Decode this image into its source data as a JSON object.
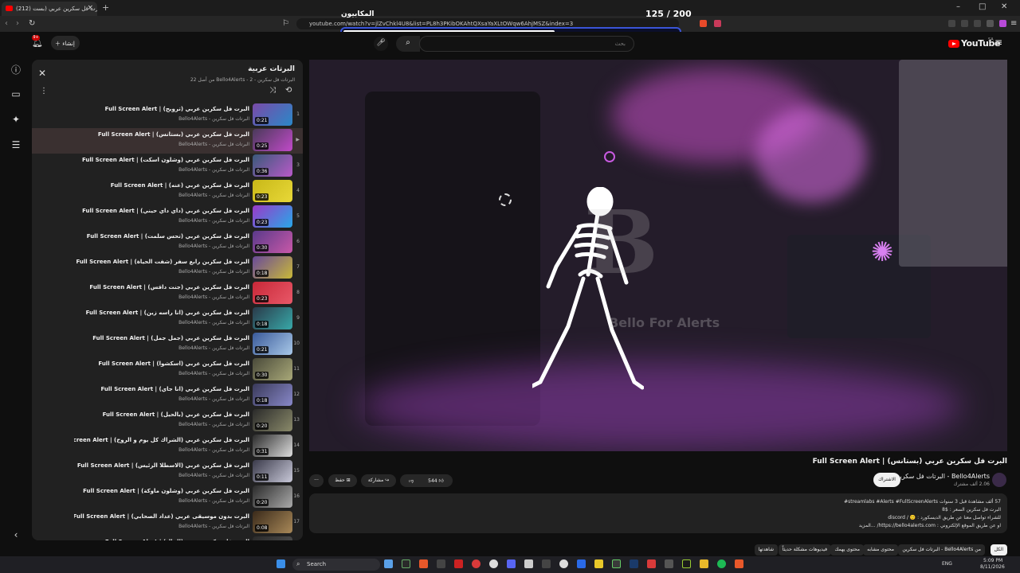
{
  "browser": {
    "tab_title": "البرت فل سكرين عربي (بست...",
    "tab_count": "(212)",
    "url": "youtube.com/watch?v=jlZvChkl4U8&list=PL8h3PKibOKAhtQXsaYaXLtOWqw6AhjMSZ&index=3"
  },
  "overlay": {
    "title": "المكابيون",
    "count": "125 / 200",
    "progress": 0.625
  },
  "header": {
    "create_label": "إنشاء",
    "search_placeholder": "بحث",
    "logo_text": "YouTube",
    "logo_region": "SA"
  },
  "playlist": {
    "title": "البرتات عربية",
    "subtitle": "البرتات فل سكرين - Bello4Alerts - 2 من أصل 22",
    "items": [
      {
        "n": "1",
        "title": "البرت فل سكرين عربي (ترويح) | Full Screen Alert",
        "channel": "البرتات فل سكرين - Bello4Alerts",
        "dur": "0:21",
        "c1": "#7a4aa8",
        "c2": "#2a88c8"
      },
      {
        "n": "▶",
        "title": "البرت فل سكرين عربي (بستانس) | Full Screen Alert",
        "channel": "البرتات فل سكرين - Bello4Alerts",
        "dur": "0:25",
        "c1": "#4a3a5a",
        "c2": "#c04ac8"
      },
      {
        "n": "3",
        "title": "البرت فل سكرين عربي (وشلون اسكت) | Full Screen Alert",
        "channel": "البرتات فل سكرين - Bello4Alerts",
        "dur": "0:36",
        "c1": "#3a5a7a",
        "c2": "#b85ac8"
      },
      {
        "n": "4",
        "title": "البرت فل سكرين عربي (عنه) | Full Screen Alert",
        "channel": "البرتات فل سكرين - Bello4Alerts",
        "dur": "0:23",
        "c1": "#c8b818",
        "c2": "#e8d838"
      },
      {
        "n": "5",
        "title": "البرت فل سكرين عربي (داي داي حيني) | Full Screen Alert",
        "channel": "البرتات فل سكرين - Bello4Alerts",
        "dur": "0:23",
        "c1": "#9a3ac8",
        "c2": "#28a8e8"
      },
      {
        "n": "6",
        "title": "البرت فل سكرين عربي (تحس سلمت) | Full Screen Alert",
        "channel": "البرتات فل سكرين - Bello4Alerts",
        "dur": "0:30",
        "c1": "#5a3a8a",
        "c2": "#c858a8"
      },
      {
        "n": "7",
        "title": "البرت فل سكرين رابع سفر (شفت الحياة) | Full Screen Alert",
        "channel": "البرتات فل سكرين - Bello4Alerts",
        "dur": "0:18",
        "c1": "#6a4a9a",
        "c2": "#c8b838"
      },
      {
        "n": "8",
        "title": "البرت فل سكرين عربي (جنت داقس) | Full Screen Alert",
        "channel": "البرتات فل سكرين - Bello4Alerts",
        "dur": "0:23",
        "c1": "#c82838",
        "c2": "#e85868"
      },
      {
        "n": "9",
        "title": "البرت فل سكرين عربي (انا راسه زين) | Full Screen Alert",
        "channel": "البرتات فل سكرين - Bello4Alerts",
        "dur": "0:18",
        "c1": "#2a3a4a",
        "c2": "#38a8a8"
      },
      {
        "n": "10",
        "title": "البرت فل سكرين عربي (جمل جمل) | Full Screen Alert",
        "channel": "البرتات فل سكرين - Bello4Alerts",
        "dur": "0:21",
        "c1": "#3a5a9a",
        "c2": "#a8c8e8"
      },
      {
        "n": "11",
        "title": "البرت فل سكرين عربي (اسكشوا) | Full Screen Alert",
        "channel": "البرتات فل سكرين - Bello4Alerts",
        "dur": "0:30",
        "c1": "#4a4a3a",
        "c2": "#a8a878"
      },
      {
        "n": "12",
        "title": "البرت فل سكرين عربي (انا جاي) | Full Screen Alert",
        "channel": "البرتات فل سكرين - Bello4Alerts",
        "dur": "0:18",
        "c1": "#3a3a5a",
        "c2": "#8888c8"
      },
      {
        "n": "13",
        "title": "البرت فل سكرين عربي (بالحيل) | Full Screen Alert",
        "channel": "البرتات فل سكرين - Bello4Alerts",
        "dur": "0:20",
        "c1": "#2a2a2a",
        "c2": "#8a8a6a"
      },
      {
        "n": "14",
        "title": "البرت فل سكرين عربي (الشراك كل يوم و الروح) | Full Screen Alert",
        "channel": "البرتات فل سكرين - Bello4Alerts",
        "dur": "0:31",
        "c1": "#2a2a2a",
        "c2": "#dddddd"
      },
      {
        "n": "15",
        "title": "البرت فل سكرين عربي (الاسطلا الرئيس) | Full Screen Alert",
        "channel": "البرتات فل سكرين - Bello4Alerts",
        "dur": "0:11",
        "c1": "#3a3a4a",
        "c2": "#c8c8d8"
      },
      {
        "n": "16",
        "title": "البرت فل سكرين عربي (وشلون ماوكة) | Full Screen Alert",
        "channel": "البرتات فل سكرين - Bello4Alerts",
        "dur": "0:20",
        "c1": "#2a2a2a",
        "c2": "#aaaaaa"
      },
      {
        "n": "17",
        "title": "البرت بدون موسيقى عربي (عداد الصحابي) | Full Screen Alert",
        "channel": "البرتات فل سكرين - Bello4Alerts",
        "dur": "0:08",
        "c1": "#3a2a1a",
        "c2": "#a88858"
      },
      {
        "n": "18",
        "title": "البرت فل سكرين عربي (الجال) | Full Screen Alert",
        "channel": "البرتات فل سكرين - Bello4Alerts",
        "dur": "",
        "c1": "#2a2a2a",
        "c2": "#555555"
      }
    ]
  },
  "video": {
    "watermark_letter": "B",
    "watermark_text": "Bello For Alerts",
    "title": "البرت فل سكرين عربي (بستانس) | Full Screen Alert",
    "channel": "Bello4Alerts - البرتات فل سكرين",
    "subscribers": "2.06 ألف مشترك",
    "subscribe_label": "الاشتراك",
    "likes": "544",
    "share_label": "مشاركة",
    "save_label": "حفظ",
    "description": [
      "57 ألف مشاهدة قبل 3 سنوات  streamlabs #Alerts #FullScreenAlerts#",
      "البرت فل سكرين السعر : $8",
      "للشراء تواصل معنا عن طريق الديسكورد : 🙂 / discord",
      "او عن طريق الموقع الإلكتروني : https://bello4alerts.com/ ...المزيد"
    ]
  },
  "chips": [
    "الكل",
    "من Bello4Alerts - البرتات فل سكرين",
    "محتوى مشابه",
    "محتوى يهمك",
    "فيديوهات مشكلة حديثاً",
    "شاهدتها"
  ],
  "taskbar": {
    "search_label": "Search",
    "lang": "ENG",
    "time": "5:09 PM",
    "date": "8/11/2026"
  }
}
